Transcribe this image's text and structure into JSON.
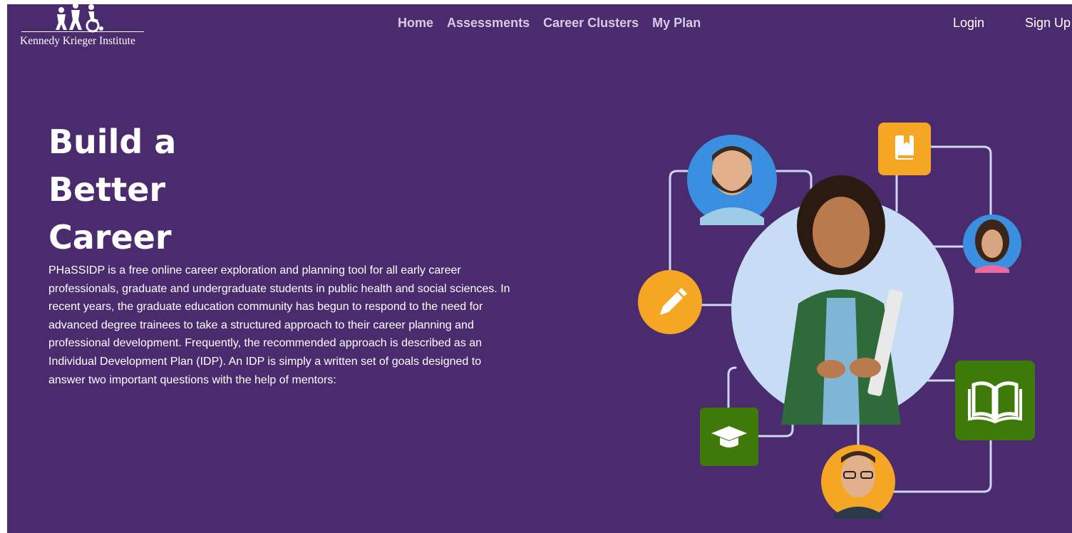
{
  "header": {
    "logo_text": "Kennedy Krieger Institute",
    "nav": [
      "Home",
      "Assessments",
      "Career Clusters",
      "My Plan"
    ],
    "login": "Login",
    "signup": "Sign Up"
  },
  "hero": {
    "title": "Build a Better Career",
    "description": "PHaSSIDP is a free online career exploration and planning tool for all early career professionals, graduate and undergraduate students in public health and social sciences. In recent years, the graduate education community has begun to respond to the need for advanced degree trainees to take a structured approach to their career planning and professional development. Frequently, the recommended approach is described as an Individual Development Plan (IDP). An IDP is simply a written set of goals designed to answer two important questions with the help of mentors:"
  },
  "colors": {
    "background": "#4a2b6e",
    "nav_text": "#d4cbe4",
    "accent_orange": "#f5a623",
    "accent_green": "#3d7a0a",
    "avatar_blue": "#3b8fe0",
    "main_circle": "#c9dcf5"
  },
  "icons": [
    "pencil-icon",
    "book-icon",
    "open-book-icon",
    "graduation-cap-icon"
  ]
}
